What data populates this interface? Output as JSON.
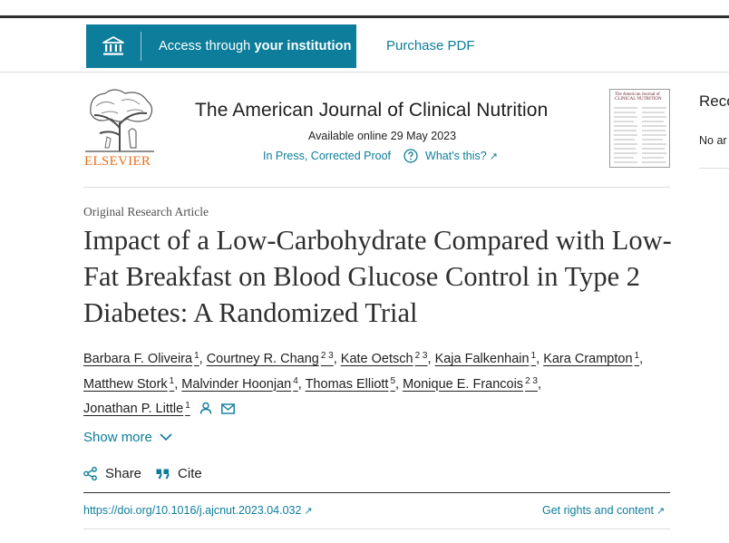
{
  "toolbar": {
    "access_prefix": "Access through ",
    "access_bold": "your institution",
    "purchase_label": "Purchase PDF"
  },
  "journal": {
    "publisher": "ELSEVIER",
    "title": "The American Journal of Clinical Nutrition",
    "available": "Available online 29 May 2023",
    "status": "In Press, Corrected Proof",
    "whats_this": "What's this?",
    "cover_title": "The American Journal of CLINICAL NUTRITION"
  },
  "sidebar": {
    "reco_title": "Reco",
    "reco_sub": "No ar"
  },
  "article": {
    "type": "Original Research Article",
    "title": "Impact of a Low-Carbohydrate Compared with Low-Fat Breakfast on Blood Glucose Control in Type 2 Diabetes: A Randomized Trial",
    "authors": [
      {
        "name": "Barbara F. Oliveira",
        "sup": "1"
      },
      {
        "name": "Courtney R. Chang",
        "sup": "2 3"
      },
      {
        "name": "Kate Oetsch",
        "sup": "2 3"
      },
      {
        "name": "Kaja Falkenhain",
        "sup": "1"
      },
      {
        "name": "Kara Crampton",
        "sup": "1"
      },
      {
        "name": "Matthew Stork",
        "sup": "1"
      },
      {
        "name": "Malvinder Hoonjan",
        "sup": "4"
      },
      {
        "name": "Thomas Elliott",
        "sup": "5"
      },
      {
        "name": "Monique E. Francois",
        "sup": "2 3"
      },
      {
        "name": "Jonathan P. Little",
        "sup": "1"
      }
    ],
    "separator": ",",
    "show_more": "Show more",
    "share_label": "Share",
    "cite_label": "Cite",
    "doi": "https://doi.org/10.1016/j.ajcnut.2023.04.032",
    "rights": "Get rights and content"
  },
  "colors": {
    "accent": "#0c7d9b",
    "publisher_orange": "#e9711c",
    "text": "#1f1f1f"
  },
  "icons": {
    "institution": "institution-icon",
    "help": "question-circle-icon",
    "external": "external-link-icon",
    "person": "person-icon",
    "mail": "envelope-icon",
    "chevron": "chevron-down-icon",
    "share": "share-icon",
    "cite": "quote-icon"
  }
}
